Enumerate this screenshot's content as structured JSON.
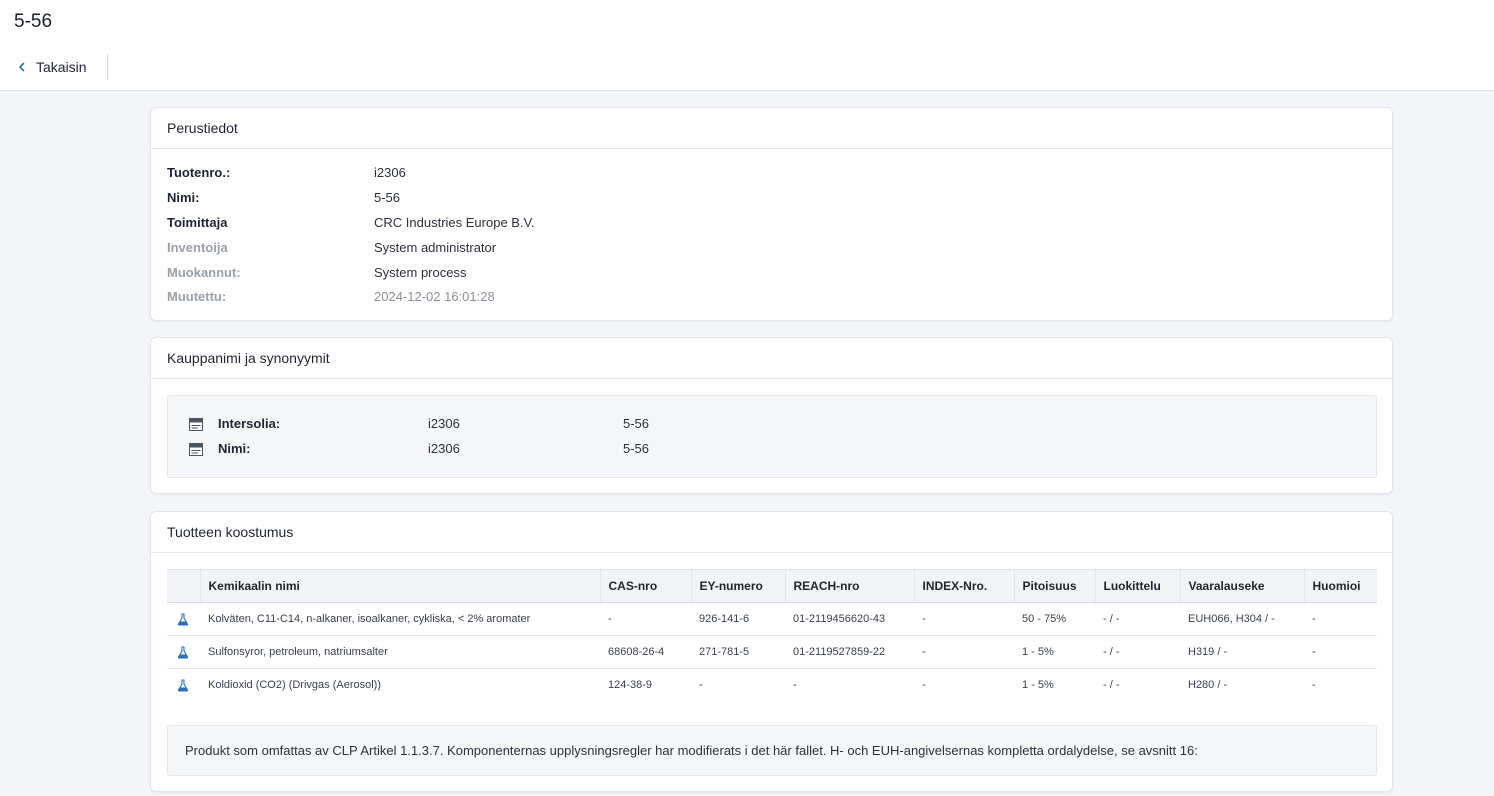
{
  "page": {
    "title": "5-56",
    "back_label": "Takaisin"
  },
  "basic": {
    "title": "Perustiedot",
    "rows": [
      {
        "label": "Tuotenro.:",
        "value": "i2306"
      },
      {
        "label": "Nimi:",
        "value": "5-56"
      },
      {
        "label": "Toimittaja",
        "value": "CRC Industries Europe B.V."
      },
      {
        "label": "Inventoija",
        "value": "System administrator"
      },
      {
        "label": "Muokannut:",
        "value": "System process"
      },
      {
        "label": "Muutettu:",
        "value": "2024-12-02 16:01:28"
      }
    ]
  },
  "trade": {
    "title": "Kauppanimi ja synonyymit",
    "rows": [
      {
        "name": "Intersolia:",
        "code": "i2306",
        "value": "5-56",
        "icon": "card-icon"
      },
      {
        "name": "Nimi:",
        "code": "i2306",
        "value": "5-56",
        "icon": "card-icon"
      }
    ]
  },
  "composition": {
    "title": "Tuotteen koostumus",
    "columns": [
      "Kemikaalin nimi",
      "CAS-nro",
      "EY-numero",
      "REACH-nro",
      "INDEX-Nro.",
      "Pitoisuus",
      "Luokittelu",
      "Vaaralauseke",
      "Huomioi"
    ],
    "rows": [
      {
        "icon": "flask-icon",
        "name": "Kolväten, C11-C14, n-alkaner, isoalkaner, cykliska, < 2% aromater",
        "cas": "-",
        "ey": "926-141-6",
        "reach": "01-2119456620-43",
        "index": "-",
        "conc": "50 - 75%",
        "class": "- / -",
        "hazard": "EUH066, H304 / -",
        "note": "-"
      },
      {
        "icon": "flask-icon",
        "name": "Sulfonsyror, petroleum, natriumsalter",
        "cas": "68608-26-4",
        "ey": "271-781-5",
        "reach": "01-2119527859-22",
        "index": "-",
        "conc": "1 - 5%",
        "class": "- / -",
        "hazard": "H319 / -",
        "note": "-"
      },
      {
        "icon": "flask-icon",
        "name": "Koldioxid (CO2) (Drivgas (Aerosol))",
        "cas": "124-38-9",
        "ey": "-",
        "reach": "-",
        "index": "-",
        "conc": "1 - 5%",
        "class": "- / -",
        "hazard": "H280 / -",
        "note": "-"
      }
    ],
    "footnote": "Produkt som omfattas av CLP Artikel 1.1.3.7. Komponenternas upplysningsregler har modifierats i det här fallet. H- och EUH-angivelsernas kompletta ordalydelse, se avsnitt 16:"
  },
  "colors": {
    "accent": "#2d6fb7",
    "background": "#f3f5f8",
    "muted_text": "#9aa0a8"
  }
}
